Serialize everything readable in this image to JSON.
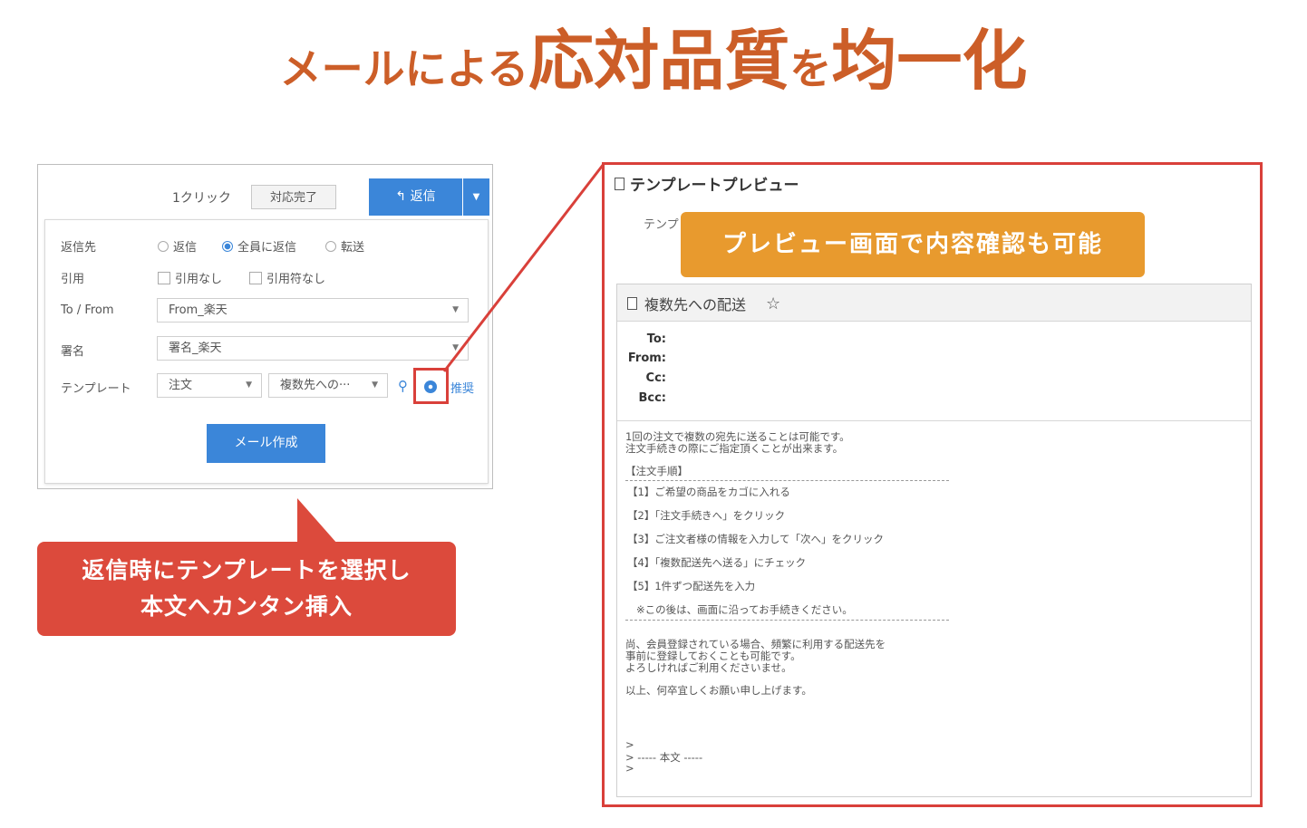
{
  "headline": {
    "part1": "メールによる",
    "part2": "応対品質",
    "part3": "を",
    "part4": "均一化"
  },
  "reply_panel": {
    "one_click": "1クリック",
    "done_button": "対応完了",
    "reply_button": "返信",
    "fields": {
      "reply_to_label": "返信先",
      "reply_to_options": [
        "返信",
        "全員に返信",
        "転送"
      ],
      "reply_to_selected": "全員に返信",
      "quote_label": "引用",
      "quote_options": [
        "引用なし",
        "引用符なし"
      ],
      "to_from_label": "To / From",
      "to_from_value": "From_楽天",
      "signature_label": "署名",
      "signature_value": "署名_楽天",
      "template_label": "テンプレート",
      "template_category": "注文",
      "template_name": "複数先への···",
      "preview_link": "推奨"
    },
    "create_mail_button": "メール作成"
  },
  "callout_left": {
    "line1": "返信時にテンプレートを選択し",
    "line2": "本文へカンタン挿入"
  },
  "preview": {
    "title": "テンプレートプレビュー",
    "template_label_partial": "テンプ",
    "callout": "プレビュー画面で内容確認も可能",
    "subject": "複数先への配送",
    "headers": {
      "to": "To:",
      "from": "From:",
      "cc": "Cc:",
      "bcc": "Bcc:"
    },
    "body": {
      "intro1": "1回の注文で複数の宛先に送ることは可能です。",
      "intro2": "注文手続きの際にご指定頂くことが出来ます。",
      "steps_title": "【注文手順】",
      "step1": "【1】ご希望の商品をカゴに入れる",
      "step2": "【2】「注文手続きへ」をクリック",
      "step3": "【3】ご注文者様の情報を入力して「次へ」をクリック",
      "step4": "【4】「複数配送先へ送る」にチェック",
      "step5": "【5】1件ずつ配送先を入力",
      "note": "※この後は、画面に沿ってお手続きください。",
      "extra1": "尚、会員登録されている場合、頻繁に利用する配送先を",
      "extra2": "事前に登録しておくことも可能です。",
      "extra3": "よろしければご利用くださいませ。",
      "closing": "以上、何卒宜しくお願い申し上げます。",
      "quote1": ">",
      "quote2": "> ----- 本文 -----",
      "quote3": ">"
    }
  },
  "colors": {
    "headline": "#cc5e28",
    "accent_blue": "#3b86d9",
    "highlight_red": "#d9403a",
    "callout_red": "#dc4a3c",
    "callout_orange": "#e89a2e"
  }
}
